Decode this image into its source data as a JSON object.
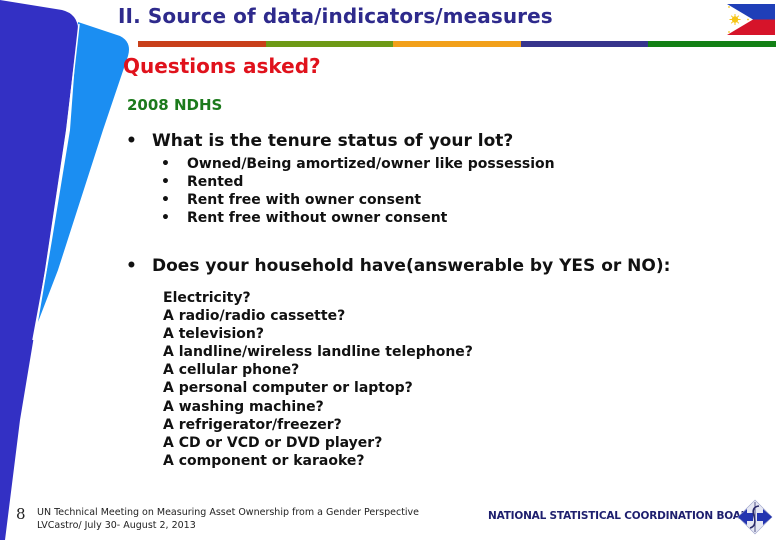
{
  "header": {
    "title": "II. Source of data/indicators/measures",
    "subtitle": "Questions asked?",
    "color_bar": [
      "#c8401a",
      "#6e9a16",
      "#f2a01a",
      "#36348c",
      "#138015"
    ],
    "flag_icon": "philippine-flag"
  },
  "content": {
    "survey_label": "2008 NDHS",
    "question1": {
      "bullet": "•",
      "text": "What is the tenure status of your lot?",
      "options": [
        "Owned/Being amortized/owner like possession",
        "Rented",
        "Rent free with owner consent",
        "Rent free without owner consent"
      ]
    },
    "question2": {
      "bullet": "•",
      "text": "Does your household have(answerable by YES or NO):",
      "items": [
        "Electricity?",
        "A radio/radio cassette?",
        "A television?",
        "A landline/wireless landline telephone?",
        "A cellular phone?",
        "A personal computer or laptop?",
        "A washing machine?",
        "A refrigerator/freezer?",
        "A CD or VCD or DVD player?",
        "A component or karaoke?"
      ]
    }
  },
  "footer": {
    "page_number": "8",
    "line1": "UN Technical Meeting on Measuring Asset Ownership from a Gender Perspective",
    "line2": "LVCastro/ July 30- August 2, 2013",
    "organization": "NATIONAL STATISTICAL COORDINATION BOARD",
    "logo_icon": "nscb-logo"
  },
  "colors": {
    "title": "#2e2a8c",
    "subtitle": "#e0121c",
    "survey_label": "#1c7a1c",
    "deco_dark_blue": "#3330c4",
    "deco_light_blue": "#1b8ef2"
  }
}
